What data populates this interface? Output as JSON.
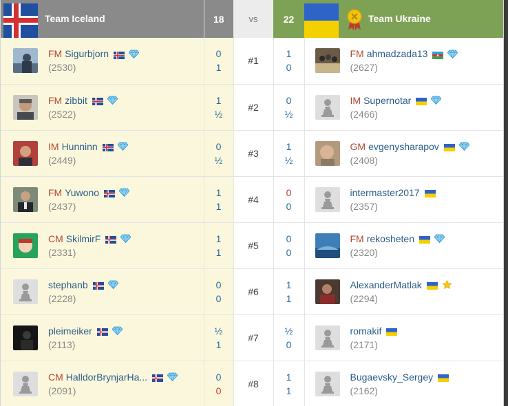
{
  "header": {
    "left_team": "Team Iceland",
    "left_score": "18",
    "vs": "vs",
    "right_score": "22",
    "right_team": "Team Ukraine"
  },
  "colors": {
    "left_header_bg": "#8a8a8a",
    "right_header_bg": "#7ea255",
    "left_row_bg": "#fbf7dc",
    "title_color": "#b5452f",
    "username_color": "#2a5d8a",
    "score_color": "#2a6aa0"
  },
  "boards": [
    {
      "board": "#1",
      "left": {
        "title": "FM",
        "name": "Sigurbjorn",
        "rating": "(2530)",
        "flag": "iceland",
        "badge": "diamond",
        "avatar": "photo-snow"
      },
      "left_scores": [
        "0",
        "1"
      ],
      "right_scores": [
        "1",
        "0"
      ],
      "right": {
        "title": "FM",
        "name": "ahmadzada13",
        "rating": "(2627)",
        "flag": "azerbaijan",
        "badge": "diamond",
        "avatar": "photo-group"
      }
    },
    {
      "board": "#2",
      "left": {
        "title": "FM",
        "name": "zibbit",
        "rating": "(2522)",
        "flag": "iceland",
        "badge": "diamond",
        "avatar": "photo-man"
      },
      "left_scores": [
        "1",
        "½"
      ],
      "right_scores": [
        "0",
        "½"
      ],
      "right": {
        "title": "IM",
        "name": "Supernotar",
        "rating": "(2466)",
        "flag": "ukraine",
        "badge": "diamond",
        "avatar": "pawn"
      }
    },
    {
      "board": "#3",
      "left": {
        "title": "IM",
        "name": "Hunninn",
        "rating": "(2449)",
        "flag": "iceland",
        "badge": "diamond",
        "avatar": "photo-red"
      },
      "left_scores": [
        "0",
        "½"
      ],
      "right_scores": [
        "1",
        "½"
      ],
      "right": {
        "title": "GM",
        "name": "evgenysharapov",
        "rating": "(2408)",
        "flag": "ukraine",
        "badge": "diamond",
        "avatar": "photo-face"
      }
    },
    {
      "board": "#4",
      "left": {
        "title": "FM",
        "name": "Yuwono",
        "rating": "(2437)",
        "flag": "iceland",
        "badge": "diamond",
        "avatar": "photo-suit"
      },
      "left_scores": [
        "1",
        "1"
      ],
      "right_scores": [
        "0",
        "0"
      ],
      "right": {
        "title": "",
        "name": "intermaster2017",
        "rating": "(2357)",
        "flag": "ukraine",
        "badge": "",
        "avatar": "pawn"
      }
    },
    {
      "board": "#5",
      "left": {
        "title": "CM",
        "name": "SkilmirF",
        "rating": "(2331)",
        "flag": "iceland",
        "badge": "diamond",
        "avatar": "photo-green"
      },
      "left_scores": [
        "1",
        "1"
      ],
      "right_scores": [
        "0",
        "0"
      ],
      "right": {
        "title": "FM",
        "name": "rekosheten",
        "rating": "(2320)",
        "flag": "ukraine",
        "badge": "diamond",
        "avatar": "photo-sky"
      }
    },
    {
      "board": "#6",
      "left": {
        "title": "",
        "name": "stephanb",
        "rating": "(2228)",
        "flag": "iceland",
        "badge": "diamond",
        "avatar": "pawn"
      },
      "left_scores": [
        "0",
        "0"
      ],
      "right_scores": [
        "1",
        "1"
      ],
      "right": {
        "title": "",
        "name": "AlexanderMatlak",
        "rating": "(2294)",
        "flag": "ukraine",
        "badge": "star",
        "avatar": "photo-dark"
      }
    },
    {
      "board": "#7",
      "left": {
        "title": "",
        "name": "pleimeiker",
        "rating": "(2113)",
        "flag": "iceland",
        "badge": "diamond",
        "avatar": "photo-black"
      },
      "left_scores": [
        "½",
        "1"
      ],
      "right_scores": [
        "½",
        "0"
      ],
      "right": {
        "title": "",
        "name": "romakif",
        "rating": "(2171)",
        "flag": "ukraine",
        "badge": "",
        "avatar": "pawn"
      }
    },
    {
      "board": "#8",
      "left": {
        "title": "CM",
        "name": "HalldorBrynjarHa...",
        "rating": "(2091)",
        "flag": "iceland",
        "badge": "diamond",
        "avatar": "pawn"
      },
      "left_scores": [
        "0",
        "0"
      ],
      "right_scores": [
        "1",
        "1"
      ],
      "right": {
        "title": "",
        "name": "Bugaevsky_Sergey",
        "rating": "(2162)",
        "flag": "ukraine",
        "badge": "",
        "avatar": "pawn"
      }
    }
  ]
}
